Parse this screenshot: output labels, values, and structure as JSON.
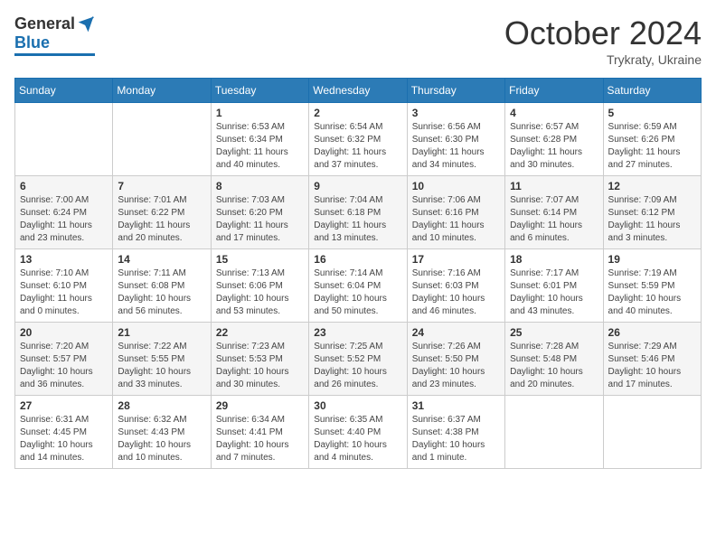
{
  "header": {
    "logo": {
      "general": "General",
      "blue": "Blue"
    },
    "title": "October 2024",
    "subtitle": "Trykraty, Ukraine"
  },
  "weekdays": [
    "Sunday",
    "Monday",
    "Tuesday",
    "Wednesday",
    "Thursday",
    "Friday",
    "Saturday"
  ],
  "weeks": [
    [
      {
        "day": "",
        "info": ""
      },
      {
        "day": "",
        "info": ""
      },
      {
        "day": "1",
        "info": "Sunrise: 6:53 AM\nSunset: 6:34 PM\nDaylight: 11 hours and 40 minutes."
      },
      {
        "day": "2",
        "info": "Sunrise: 6:54 AM\nSunset: 6:32 PM\nDaylight: 11 hours and 37 minutes."
      },
      {
        "day": "3",
        "info": "Sunrise: 6:56 AM\nSunset: 6:30 PM\nDaylight: 11 hours and 34 minutes."
      },
      {
        "day": "4",
        "info": "Sunrise: 6:57 AM\nSunset: 6:28 PM\nDaylight: 11 hours and 30 minutes."
      },
      {
        "day": "5",
        "info": "Sunrise: 6:59 AM\nSunset: 6:26 PM\nDaylight: 11 hours and 27 minutes."
      }
    ],
    [
      {
        "day": "6",
        "info": "Sunrise: 7:00 AM\nSunset: 6:24 PM\nDaylight: 11 hours and 23 minutes."
      },
      {
        "day": "7",
        "info": "Sunrise: 7:01 AM\nSunset: 6:22 PM\nDaylight: 11 hours and 20 minutes."
      },
      {
        "day": "8",
        "info": "Sunrise: 7:03 AM\nSunset: 6:20 PM\nDaylight: 11 hours and 17 minutes."
      },
      {
        "day": "9",
        "info": "Sunrise: 7:04 AM\nSunset: 6:18 PM\nDaylight: 11 hours and 13 minutes."
      },
      {
        "day": "10",
        "info": "Sunrise: 7:06 AM\nSunset: 6:16 PM\nDaylight: 11 hours and 10 minutes."
      },
      {
        "day": "11",
        "info": "Sunrise: 7:07 AM\nSunset: 6:14 PM\nDaylight: 11 hours and 6 minutes."
      },
      {
        "day": "12",
        "info": "Sunrise: 7:09 AM\nSunset: 6:12 PM\nDaylight: 11 hours and 3 minutes."
      }
    ],
    [
      {
        "day": "13",
        "info": "Sunrise: 7:10 AM\nSunset: 6:10 PM\nDaylight: 11 hours and 0 minutes."
      },
      {
        "day": "14",
        "info": "Sunrise: 7:11 AM\nSunset: 6:08 PM\nDaylight: 10 hours and 56 minutes."
      },
      {
        "day": "15",
        "info": "Sunrise: 7:13 AM\nSunset: 6:06 PM\nDaylight: 10 hours and 53 minutes."
      },
      {
        "day": "16",
        "info": "Sunrise: 7:14 AM\nSunset: 6:04 PM\nDaylight: 10 hours and 50 minutes."
      },
      {
        "day": "17",
        "info": "Sunrise: 7:16 AM\nSunset: 6:03 PM\nDaylight: 10 hours and 46 minutes."
      },
      {
        "day": "18",
        "info": "Sunrise: 7:17 AM\nSunset: 6:01 PM\nDaylight: 10 hours and 43 minutes."
      },
      {
        "day": "19",
        "info": "Sunrise: 7:19 AM\nSunset: 5:59 PM\nDaylight: 10 hours and 40 minutes."
      }
    ],
    [
      {
        "day": "20",
        "info": "Sunrise: 7:20 AM\nSunset: 5:57 PM\nDaylight: 10 hours and 36 minutes."
      },
      {
        "day": "21",
        "info": "Sunrise: 7:22 AM\nSunset: 5:55 PM\nDaylight: 10 hours and 33 minutes."
      },
      {
        "day": "22",
        "info": "Sunrise: 7:23 AM\nSunset: 5:53 PM\nDaylight: 10 hours and 30 minutes."
      },
      {
        "day": "23",
        "info": "Sunrise: 7:25 AM\nSunset: 5:52 PM\nDaylight: 10 hours and 26 minutes."
      },
      {
        "day": "24",
        "info": "Sunrise: 7:26 AM\nSunset: 5:50 PM\nDaylight: 10 hours and 23 minutes."
      },
      {
        "day": "25",
        "info": "Sunrise: 7:28 AM\nSunset: 5:48 PM\nDaylight: 10 hours and 20 minutes."
      },
      {
        "day": "26",
        "info": "Sunrise: 7:29 AM\nSunset: 5:46 PM\nDaylight: 10 hours and 17 minutes."
      }
    ],
    [
      {
        "day": "27",
        "info": "Sunrise: 6:31 AM\nSunset: 4:45 PM\nDaylight: 10 hours and 14 minutes."
      },
      {
        "day": "28",
        "info": "Sunrise: 6:32 AM\nSunset: 4:43 PM\nDaylight: 10 hours and 10 minutes."
      },
      {
        "day": "29",
        "info": "Sunrise: 6:34 AM\nSunset: 4:41 PM\nDaylight: 10 hours and 7 minutes."
      },
      {
        "day": "30",
        "info": "Sunrise: 6:35 AM\nSunset: 4:40 PM\nDaylight: 10 hours and 4 minutes."
      },
      {
        "day": "31",
        "info": "Sunrise: 6:37 AM\nSunset: 4:38 PM\nDaylight: 10 hours and 1 minute."
      },
      {
        "day": "",
        "info": ""
      },
      {
        "day": "",
        "info": ""
      }
    ]
  ]
}
